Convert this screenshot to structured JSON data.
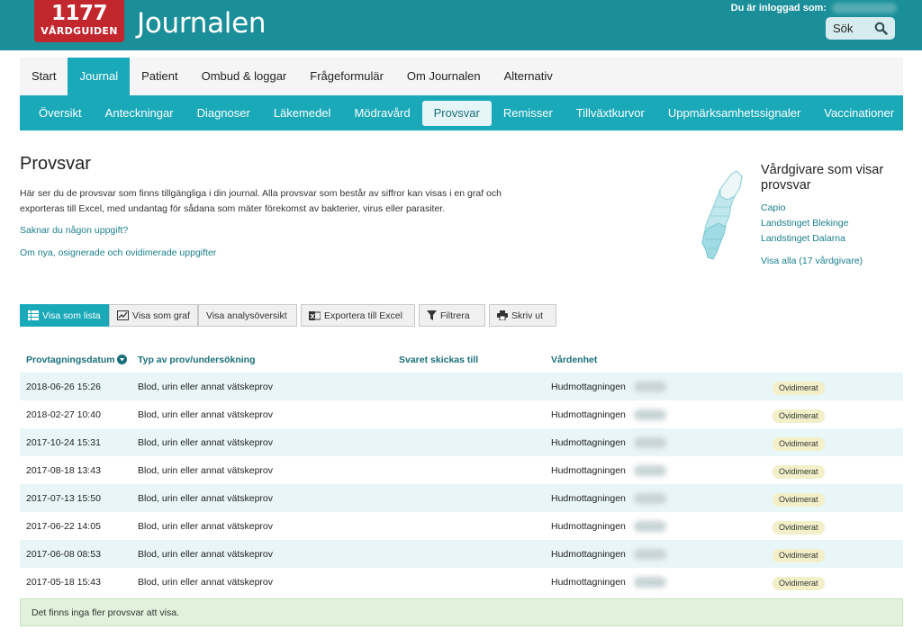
{
  "header": {
    "logo_number": "1177",
    "logo_text": "VÅRDGUIDEN",
    "app_title": "Journalen",
    "logged_in_label": "Du är inloggad som:",
    "search_label": "Sök"
  },
  "main_nav": [
    "Start",
    "Journal",
    "Patient",
    "Ombud & loggar",
    "Frågeformulär",
    "Om Journalen",
    "Alternativ"
  ],
  "sub_nav": [
    "Översikt",
    "Anteckningar",
    "Diagnoser",
    "Läkemedel",
    "Mödravård",
    "Provsvar",
    "Remisser",
    "Tillväxtkurvor",
    "Uppmärksamhetssignaler",
    "Vaccinationer"
  ],
  "page": {
    "title": "Provsvar",
    "intro": "Här ser du de provsvar som finns tillgängliga i din journal. Alla provsvar som består av siffror kan visas i en graf och exporteras till Excel, med undantag för sådana som mäter förekomst av bakterier, virus eller parasiter.",
    "link_missing": "Saknar du någon uppgift?",
    "link_about": "Om nya, osignerade och ovidimerade uppgifter"
  },
  "providers": {
    "title": "Vårdgivare som visar provsvar",
    "items": [
      "Capio",
      "Landstinget Blekinge",
      "Landstinget Dalarna"
    ],
    "show_all": "Visa alla (17 vårdgivare)"
  },
  "toolbar": {
    "list": "Visa som lista",
    "graph": "Visa som graf",
    "analysis": "Visa analysöversikt",
    "export": "Exportera till Excel",
    "filter": "Filtrera",
    "print": "Skriv ut"
  },
  "table": {
    "headers": [
      "Provtagningsdatum",
      "Typ av prov/undersökning",
      "Svaret skickas till",
      "Vårdenhet"
    ],
    "rows": [
      {
        "date": "2018-06-26 15:26",
        "type": "Blod, urin eller annat vätskeprov",
        "unit": "Hudmottagningen",
        "status": "Ovidimerat"
      },
      {
        "date": "2018-02-27 10:40",
        "type": "Blod, urin eller annat vätskeprov",
        "unit": "Hudmottagningen",
        "status": "Ovidimerat"
      },
      {
        "date": "2017-10-24 15:31",
        "type": "Blod, urin eller annat vätskeprov",
        "unit": "Hudmottagningen",
        "status": "Ovidimerat"
      },
      {
        "date": "2017-08-18 13:43",
        "type": "Blod, urin eller annat vätskeprov",
        "unit": "Hudmottagningen",
        "status": "Ovidimerat"
      },
      {
        "date": "2017-07-13 15:50",
        "type": "Blod, urin eller annat vätskeprov",
        "unit": "Hudmottagningen",
        "status": "Ovidimerat"
      },
      {
        "date": "2017-06-22 14:05",
        "type": "Blod, urin eller annat vätskeprov",
        "unit": "Hudmottagningen",
        "status": "Ovidimerat"
      },
      {
        "date": "2017-06-08 08:53",
        "type": "Blod, urin eller annat vätskeprov",
        "unit": "Hudmottagningen",
        "status": "Ovidimerat"
      },
      {
        "date": "2017-05-18 15:43",
        "type": "Blod, urin eller annat vätskeprov",
        "unit": "Hudmottagningen",
        "status": "Ovidimerat"
      }
    ],
    "footer": "Det finns inga fler provsvar att visa."
  },
  "colors": {
    "brand": "#1a8f9a",
    "accent": "#1aa9b8",
    "logo": "#c1272d"
  }
}
